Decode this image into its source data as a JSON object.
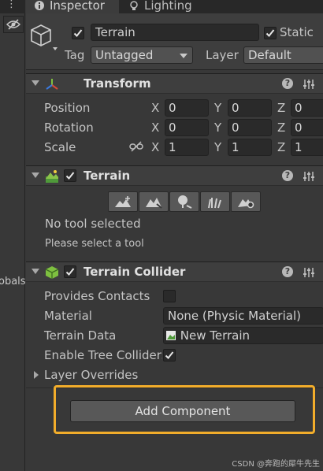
{
  "tabs": {
    "inspector": "Inspector",
    "lighting": "Lighting"
  },
  "gameobject": {
    "name": "Terrain",
    "static_label": "Static",
    "tag_label": "Tag",
    "tag_value": "Untagged",
    "layer_label": "Layer",
    "layer_value": "Default"
  },
  "transform": {
    "title": "Transform",
    "position_label": "Position",
    "rotation_label": "Rotation",
    "scale_label": "Scale",
    "axis_x": "X",
    "axis_y": "Y",
    "axis_z": "Z",
    "position": [
      "0",
      "0",
      "0"
    ],
    "rotation": [
      "0",
      "0",
      "0"
    ],
    "scale": [
      "1",
      "1",
      "1"
    ]
  },
  "terrain": {
    "title": "Terrain",
    "no_tool": "No tool selected",
    "hint": "Please select a tool",
    "tools": [
      "raise-terrain-icon",
      "paint-terrain-icon",
      "paint-trees-icon",
      "paint-details-icon",
      "terrain-settings-icon"
    ]
  },
  "collider": {
    "title": "Terrain Collider",
    "provides_contacts_label": "Provides Contacts",
    "material_label": "Material",
    "material_value": "None (Physic Material)",
    "terrain_data_label": "Terrain Data",
    "terrain_data_value": "New Terrain",
    "enable_tree_label": "Enable Tree Colliders",
    "layer_overrides_label": "Layer Overrides"
  },
  "add_component": "Add Component",
  "left_panel_text": "obals",
  "watermark": "CSDN @奔跑的犀牛先生",
  "colors": {
    "background": "#383838",
    "field": "#2a2a2a",
    "highlight": "#f2ad2b"
  }
}
